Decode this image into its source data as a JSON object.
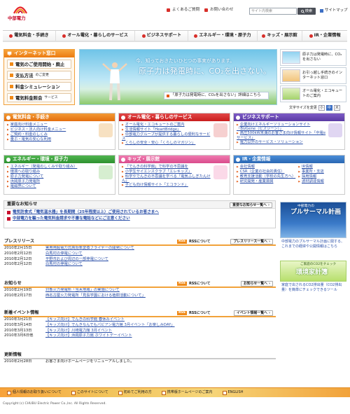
{
  "brand": {
    "name": "中部電力",
    "color": "#c8102e"
  },
  "header": {
    "faq": "よくあるご質問",
    "contact": "お問い合わせ",
    "search_placeholder": "サイト内検索",
    "search_button": "検索",
    "sitemap": "サイトマップ"
  },
  "nav": [
    "電気料金・手続き",
    "オール電化・暮らしのサービス",
    "ビジネスサポート",
    "エネルギー・環境・原子力",
    "キッズ・展示館",
    "IR・企業情報"
  ],
  "internet": {
    "title": "インターネット窓口",
    "items": [
      {
        "label": "電気のご使用開始・廃止",
        "small": ""
      },
      {
        "label": "支払方法",
        "small": "のご変更"
      },
      {
        "label": "料金シミュレーション",
        "small": ""
      },
      {
        "label": "電気料金照会",
        "small": "サービス"
      }
    ]
  },
  "hero": {
    "line1": "今、知っておきたいひとつの事実があります。",
    "line2": "原子力は発電時に、CO₂を出さない。",
    "link": "「原子力は発電時に、CO₂を出さない」詳細はこちら"
  },
  "promos": [
    {
      "text": "原子力は発電時に、CO₂を出さない"
    },
    {
      "text": "お引っ越し手続きのインターネット窓口"
    },
    {
      "text": "オール電化・エコキュートのご案内"
    }
  ],
  "textsize": {
    "label": "文字サイズを変更",
    "small": "小",
    "medium": "中",
    "large": "大"
  },
  "categories": {
    "bill": {
      "title": "電気料金・手続き",
      "items": [
        "家庭向け料金メニュー",
        "ビジネス・法人向け料金メニュー",
        "ご契約・料金のしくみ",
        "量ホ・電気の安心な利用"
      ]
    },
    "allelec": {
      "title": "オール電化・暮らしのサービス",
      "items": [
        "オール電化・エコキュートのご案内",
        "生活情報サイト「HeartBridge」",
        "中部電力グループが提供する暮らしの便利なサービス",
        "くらしの安全・安心「くらしのマガジン」"
      ]
    },
    "business": {
      "title": "ビジネスサポート",
      "items": [
        "企業向けエネルギーソリューションサイト「BizGene（ビズジーン）」",
        "高圧500kW未満のお客さま向け情報サイト「中電eサービス」",
        "電力以外のサービス・ソリューション"
      ]
    },
    "energy": {
      "title": "エネルギー・環境・原子力",
      "items": [
        "エネルギー（発電のしくみや取り組み）",
        "環境への取り組み",
        "原子力発電について",
        "浜岡原子力発電所",
        "電磁界について"
      ]
    },
    "kids": {
      "title": "キッズ・展示館",
      "items": [
        "「でんきの科学館」で科学の不思議を",
        "小学生サイエンスクラブ「エレキッズ」",
        "科学やでんきの不思議を学べる「電気ふしぎたんけん」",
        "子ども向け情報サイト「エコランド」"
      ]
    },
    "ir": {
      "title": "IR・企業情報",
      "items": [
        "会社情報",
        "IR情報",
        "CSR（企業の社会的責任）",
        "事業所・支店",
        "教育支援活動（学校の先生方へ）",
        "採用情報",
        "研究開発・産業振興",
        "波材調達情報"
      ]
    }
  },
  "important": {
    "title": "重要なお知らせ",
    "list_btn": "重要なお知らせ一覧へ",
    "items": [
      "電気防食式「電気温水器」を長期間（25年程度以上）ご使用されているお客さまへ",
      "中部電力を騙った電気料金請求や不審な電話などにご注意ください"
    ]
  },
  "press": {
    "title": "プレスリリース",
    "rss": "RSSについて",
    "list_btn": "プレスリリース一覧へ",
    "items": [
      {
        "date": "2010年2月15日",
        "title": "実用用超電力式高効率変換フライヤーの開発について"
      },
      {
        "date": "2010年2月12日",
        "title": "白馬村の停電について"
      },
      {
        "date": "2010年2月12日",
        "title": "平野市および周辺の一部停電について"
      },
      {
        "date": "2010年2月12日",
        "title": "白馬村の停電について"
      }
    ]
  },
  "notice": {
    "title": "お知らせ",
    "rss": "RSSについて",
    "list_btn": "お知らせ一覧へ",
    "items": [
      {
        "date": "2010年2月19日",
        "title": "対象火力発電所「当木地域」の実施について"
      },
      {
        "date": "2010年2月17日",
        "title": "西名古屋火力発電所「見島学園における植樹活動について」"
      }
    ]
  },
  "events": {
    "title": "新着イベント情報",
    "rss": "RSSについて",
    "list_btn": "イベント情報一覧へ",
    "items": [
      {
        "date": "2010年3月21日",
        "title": "【キッズ向け】でんきの科学館 春休みイベント"
      },
      {
        "date": "2010年3月14日",
        "title": "【キッズ向け】でんきなんでもパビアン電力館 3月イベント「お楽しみDAY」"
      },
      {
        "date": "2010年3月13日",
        "title": "【キッズ向け】川崎電力館 3月イベント"
      },
      {
        "date": "2010年3月6日他",
        "title": "【キッズ向け】浜岡原子力館 ホワイトデーイベント"
      }
    ]
  },
  "updates": {
    "title": "更新情報",
    "items": [
      {
        "date": "2010年2月28日",
        "title": "お客さま向けホームページをリニューアルしました。"
      }
    ]
  },
  "side": {
    "pluthermal_small": "中部電力の",
    "pluthermal_big": "プルサーマル計画",
    "pluthermal_desc": "中部電力のプルサーマル計画に関する、これまでの経緯や公開情報はこちら",
    "eco_small": "ご家庭のCO2をチェック",
    "eco_big": "環境家計簿",
    "eco_desc": "家庭で出されるCO2排出量（CO2排出量）を簡単にチェックできるツール"
  },
  "footer": [
    "個人情報のお取り扱いについて",
    "このサイトについて",
    "初めてご利用の方",
    "携帯版ホームページのご案内",
    "ENGLISH"
  ],
  "copyright": "Copyright (c) CHUBU Electric Power Co.,Inc. All Rights Reserved."
}
